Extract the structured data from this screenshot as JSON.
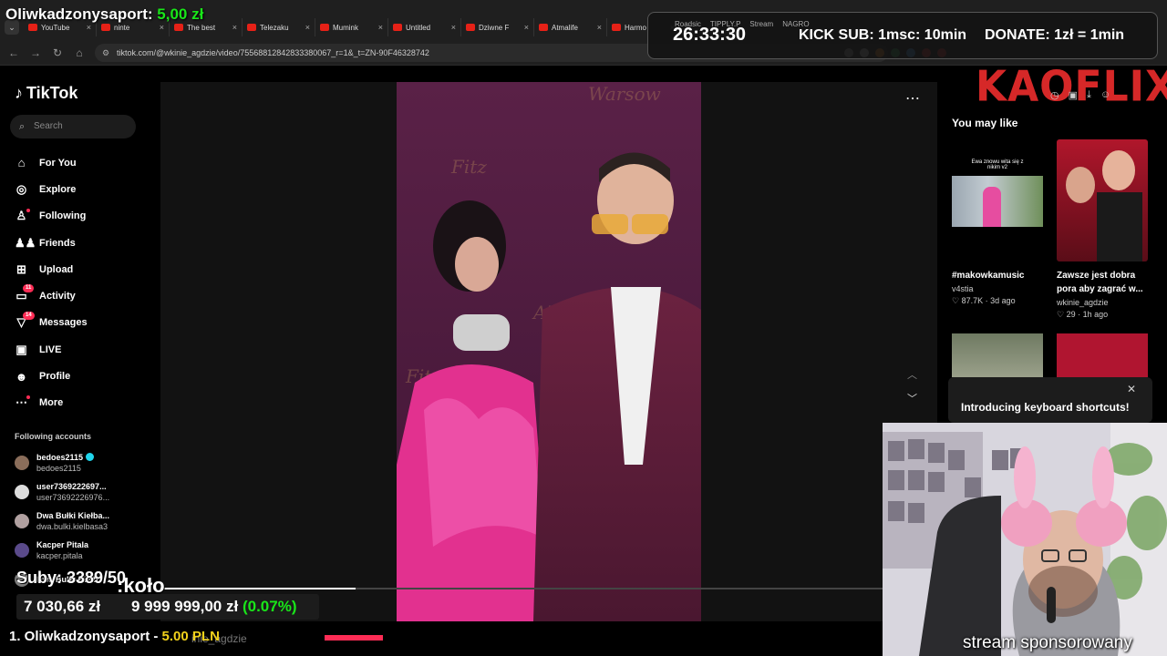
{
  "browser": {
    "tabs": [
      {
        "label": "YouTube"
      },
      {
        "label": "ninte"
      },
      {
        "label": "The best"
      },
      {
        "label": "Telezaku"
      },
      {
        "label": "Mumink"
      },
      {
        "label": "Untitled"
      },
      {
        "label": "Dziwne F"
      },
      {
        "label": "Atmalife"
      },
      {
        "label": "Harmo"
      }
    ],
    "url": "tiktok.com/@wkinie_agdzie/video/75568812842833380067_r=1&_t=ZN-90F46328742",
    "mini_tabs": [
      "Roadsic",
      "TIPPLY.P",
      "Stream",
      "NAGRO"
    ]
  },
  "overlay": {
    "top_donor_name": "Oliwkadzonysaport:",
    "top_donor_amount": "5,00 zł",
    "timer": "26:33:30",
    "kick_sub": "KICK SUB: 1msc: 10min",
    "donate": "DONATE: 1zł = 1min",
    "brand": "KAOFLIX",
    "subs": "Suby: 3389/50",
    "kolo": ":koło",
    "money_current": "7 030,66 zł",
    "money_goal": "9 999 999,00 zł",
    "money_pct": "(0.07%)",
    "donor_list": "1. Oliwkadzonysaport -",
    "donor_list_amount": "5.00 PLN",
    "ghost_user": "inie_agdzie",
    "sponsor": "stream sponsorowany"
  },
  "tiktok": {
    "logo": "TikTok",
    "search_placeholder": "Search",
    "menu": [
      {
        "label": "For You",
        "icon": "home-icon"
      },
      {
        "label": "Explore",
        "icon": "compass-icon"
      },
      {
        "label": "Following",
        "icon": "user-icon"
      },
      {
        "label": "Friends",
        "icon": "friends-icon"
      },
      {
        "label": "Upload",
        "icon": "upload-icon"
      },
      {
        "label": "Activity",
        "icon": "activity-icon",
        "badge": "11"
      },
      {
        "label": "Messages",
        "icon": "messages-icon",
        "badge": "14"
      },
      {
        "label": "LIVE",
        "icon": "live-icon"
      },
      {
        "label": "Profile",
        "icon": "profile-icon"
      },
      {
        "label": "More",
        "icon": "more-icon"
      }
    ],
    "following_title": "Following accounts",
    "following": [
      {
        "name": "bedoes2115",
        "handle": "bedoes2115",
        "verified": true
      },
      {
        "name": "user7369222697...",
        "handle": "user73692226976...",
        "verified": false
      },
      {
        "name": "Dwa Bułki Kiełba...",
        "handle": "dwa.bulki.kielbasa3",
        "verified": false
      },
      {
        "name": "Kacper Pitala",
        "handle": "kacper.pitala",
        "verified": false
      },
      {
        "name": "Dwa Bułki Kiełba...",
        "handle": "",
        "verified": false
      }
    ],
    "you_may_like": "You may like",
    "suggestions": [
      {
        "title": "#makowkamusic",
        "user": "v4stia",
        "likes": "87.7K",
        "age": "3d ago",
        "thumb_text": "Ewa znowu wita się z nikim v2"
      },
      {
        "title": "Zawsze jest dobra pora aby zagrać w...",
        "user": "wkinie_agdzie",
        "likes": "29",
        "age": "1h ago",
        "thumb_text": ""
      }
    ],
    "popup_title": "Introducing keyboard shortcuts!",
    "video_progress": 0.27
  }
}
